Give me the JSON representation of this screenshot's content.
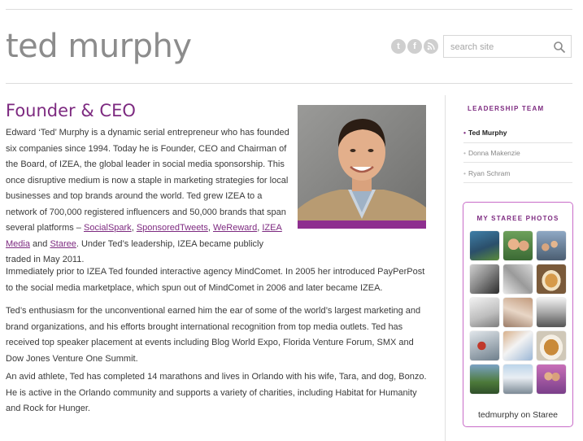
{
  "header": {
    "site_title": "ted murphy",
    "search_placeholder": "search site",
    "social_icons": [
      "twitter-icon",
      "facebook-icon",
      "rss-icon"
    ]
  },
  "main": {
    "heading": "Founder & CEO",
    "p1_text": "Edward ‘Ted’ Murphy is a dynamic serial entrepreneur who has founded six companies since 1994. Today he is Founder, CEO and Chairman of the Board, of IZEA, the global leader in social media sponsorship. This once disruptive medium is now a staple in marketing strategies for local businesses and top brands around the world. Ted grew IZEA to a network of 700,000 registered influencers and 50,000 brands that span several platforms – ",
    "links": [
      "SocialSpark",
      "SponsoredTweets",
      "WeReward",
      "IZEA Media",
      "Staree"
    ],
    "sep_comma": ", ",
    "sep_and": " and ",
    "p1_tail": ". Under Ted’s leadership, IZEA became publicly traded in May 2011.",
    "p2": "Immediately prior to IZEA Ted founded interactive agency MindComet. In 2005 her introduced PayPerPost to the social media marketplace, which spun out of MindComet in 2006 and later became IZEA.",
    "p3": "Ted’s enthusiasm for the unconventional earned him the ear of some of the world’s largest marketing and brand organizations, and his efforts brought international recognition from top media outlets. Ted has received top speaker placement at events including Blog World Expo, Florida Venture Forum, SMX and Dow Jones Venture One Summit.",
    "p4": "An avid athlete, Ted has completed 14 marathons and lives in Orlando with his wife, Tara, and dog, Bonzo. He is active in the Orlando community and supports a variety of charities, including Habitat for Humanity and Rock for Hunger."
  },
  "sidebar": {
    "leadership_title": "LEADERSHIP TEAM",
    "bullet": "•",
    "leaders": [
      {
        "name": "Ted Murphy",
        "active": true
      },
      {
        "name": "Donna Makenzie",
        "active": false
      },
      {
        "name": "Ryan Schram",
        "active": false
      }
    ],
    "photos_title": "MY STAREE PHOTOS",
    "staree_link": "tedmurphy on Staree"
  },
  "colors": {
    "accent": "#7d2a80",
    "title_gray": "#8c8c8c",
    "border_pink": "#c86cc8"
  }
}
